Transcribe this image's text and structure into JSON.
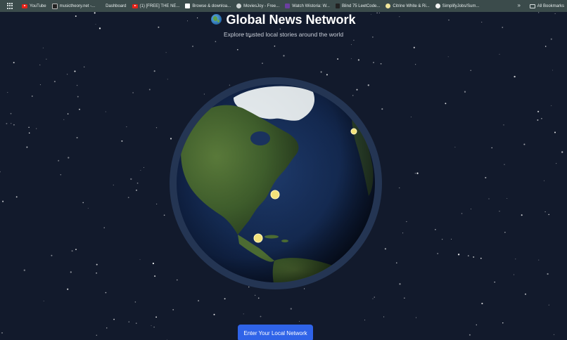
{
  "bookmarks": [
    {
      "label": "YouTube",
      "icon": "youtube-icon"
    },
    {
      "label": "musictheory.net -...",
      "icon": "musictheory-icon"
    },
    {
      "label": "Dashboard",
      "icon": "dashboard-icon"
    },
    {
      "label": "(1) [FREE] THE NE...",
      "icon": "youtube-icon"
    },
    {
      "label": "Browse & downloa...",
      "icon": "s-icon"
    },
    {
      "label": "MoviesJoy - Free...",
      "icon": "globe-icon"
    },
    {
      "label": "Watch Wistoria: W...",
      "icon": "w-icon"
    },
    {
      "label": "Blind 75 LeetCode...",
      "icon": "leetcode-icon"
    },
    {
      "label": "Citrine White & Ri...",
      "icon": "citrine-icon"
    },
    {
      "label": "SimplifyJobs/Sum...",
      "icon": "github-icon"
    }
  ],
  "bookmarks_more": "»",
  "all_bookmarks": "All Bookmarks",
  "page": {
    "title": "Global News Network",
    "subtitle": "Explore trusted local stories around the world",
    "enter_button": "Enter Your Local Network"
  },
  "colors": {
    "background": "#121a2c",
    "marker": "#f3e27a",
    "button": "#2f63e8"
  },
  "globe": {
    "markers": [
      {
        "name": "marker-east-coast-us"
      },
      {
        "name": "marker-florida"
      },
      {
        "name": "marker-greenland-coast"
      }
    ]
  }
}
